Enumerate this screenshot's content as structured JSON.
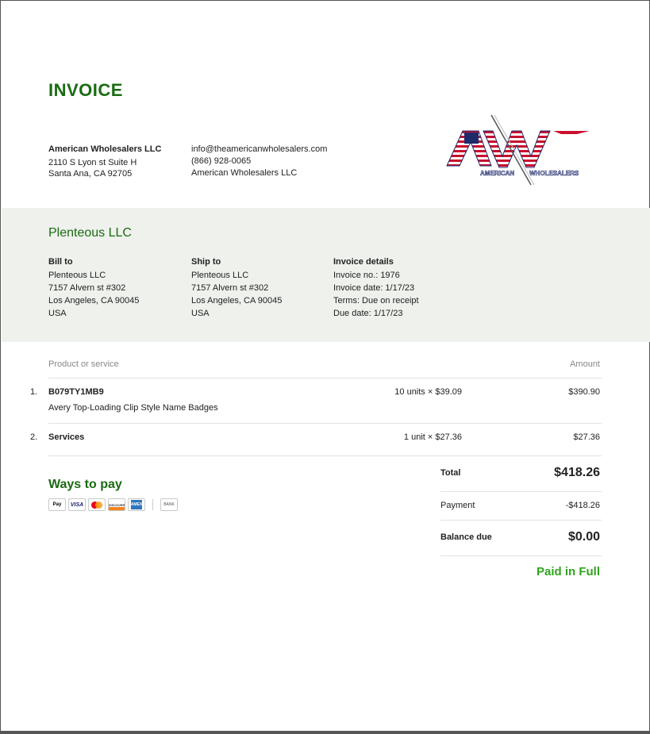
{
  "title": "INVOICE",
  "seller": {
    "name": "American Wholesalers LLC",
    "address1": "2110 S Lyon st Suite H",
    "address2": "Santa Ana, CA 92705"
  },
  "contact": {
    "email": "info@theamericanwholesalers.com",
    "phone": "(866) 928-0065",
    "company": "American Wholesalers LLC"
  },
  "logo": {
    "letters": "AW",
    "caption_left": "AMERICAN",
    "caption_right": "WHOLESALERS",
    "colors": {
      "red": "#c8102e",
      "blue": "#1f2a6b"
    }
  },
  "client": {
    "name": "Plenteous LLC"
  },
  "bill_to": {
    "heading": "Bill to",
    "lines": [
      "Plenteous LLC",
      "7157 Alvern st #302",
      "Los Angeles, CA 90045",
      "USA"
    ]
  },
  "ship_to": {
    "heading": "Ship to",
    "lines": [
      "Plenteous LLC",
      "7157 Alvern st #302",
      "Los Angeles, CA 90045",
      "USA"
    ]
  },
  "details": {
    "heading": "Invoice details",
    "lines": [
      "Invoice no.: 1976",
      "Invoice date: 1/17/23",
      "Terms: Due on receipt",
      "Due date: 1/17/23"
    ]
  },
  "table": {
    "col_product": "Product or service",
    "col_amount": "Amount",
    "rows": [
      {
        "num": "1.",
        "name": "B079TY1MB9",
        "desc": "Avery Top-Loading Clip Style Name Badges",
        "qty": "10 units × $39.09",
        "amount": "$390.90"
      },
      {
        "num": "2.",
        "name": "Services",
        "desc": "",
        "qty": "1 unit × $27.36",
        "amount": "$27.36"
      }
    ]
  },
  "ways_to_pay": {
    "heading": "Ways to pay",
    "icons": [
      {
        "name": "apple-pay-icon",
        "label": "Pay"
      },
      {
        "name": "visa-icon",
        "label": "VISA"
      },
      {
        "name": "mastercard-icon",
        "label": ""
      },
      {
        "name": "discover-icon",
        "label": "DISCOVER"
      },
      {
        "name": "amex-icon",
        "label": "AMEX"
      },
      {
        "name": "bank-icon",
        "label": "BANK"
      }
    ]
  },
  "summary": {
    "total_label": "Total",
    "total_value": "$418.26",
    "payment_label": "Payment",
    "payment_value": "-$418.26",
    "balance_label": "Balance due",
    "balance_value": "$0.00",
    "status": "Paid in Full"
  },
  "colors": {
    "accent_green": "#1a6b12",
    "paid_green": "#2fa51c",
    "band_bg": "#eef1ec"
  }
}
